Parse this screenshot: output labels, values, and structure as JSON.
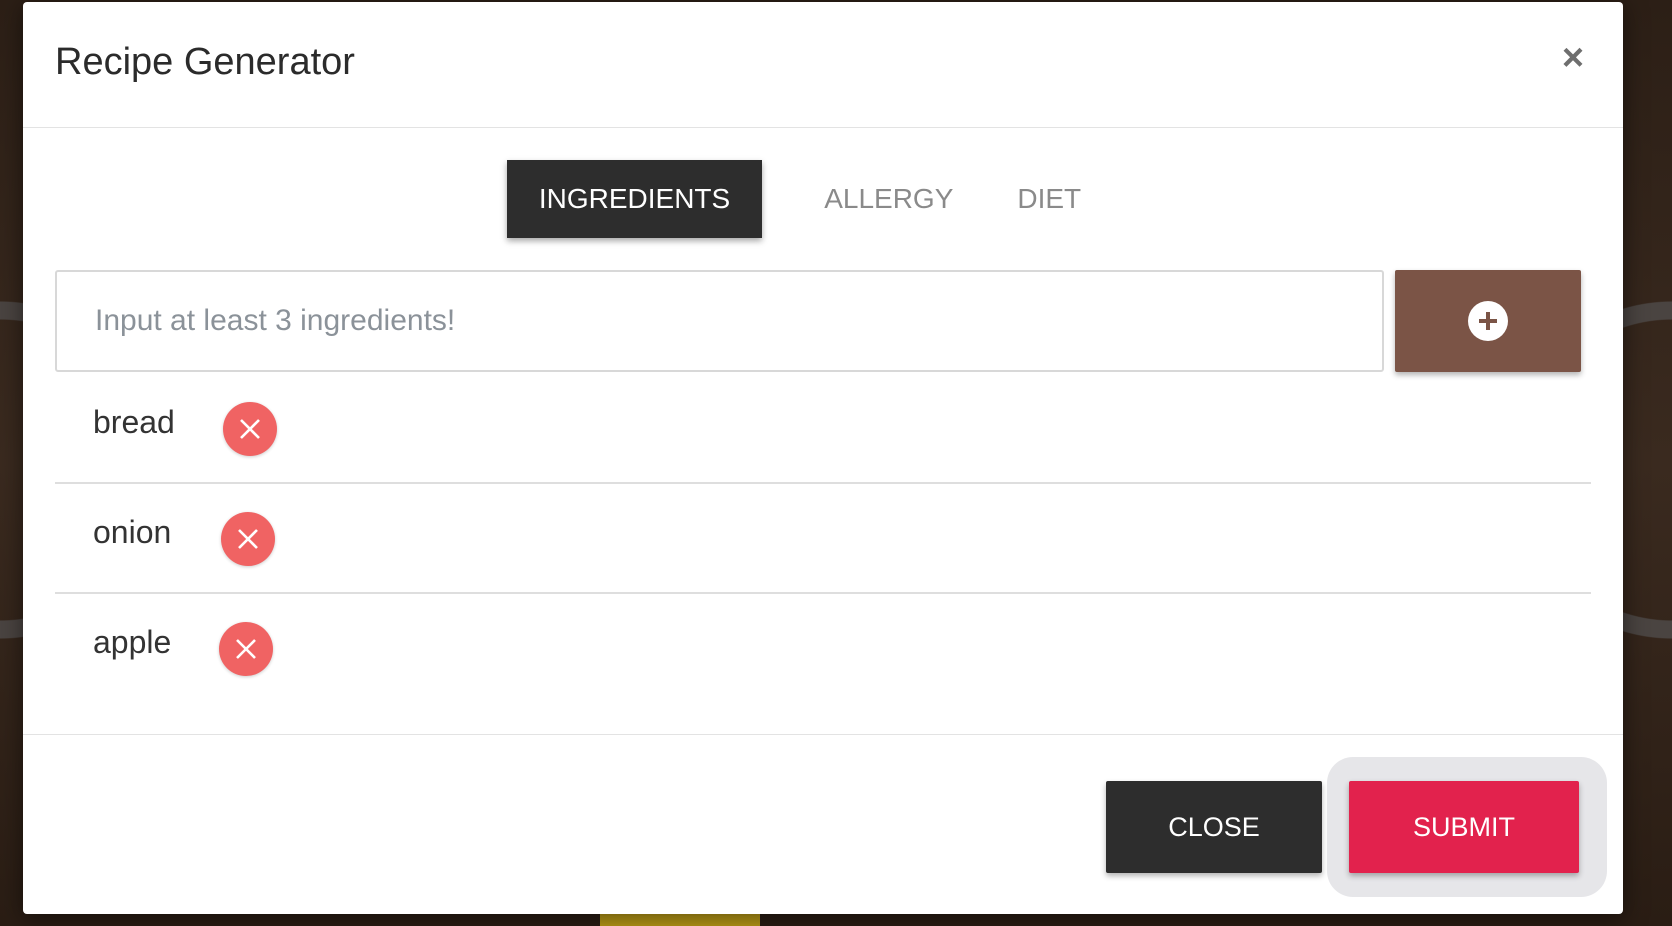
{
  "modal": {
    "title": "Recipe Generator",
    "close_glyph": "×"
  },
  "tabs": [
    {
      "label": "INGREDIENTS",
      "active": true
    },
    {
      "label": "ALLERGY",
      "active": false
    },
    {
      "label": "DIET",
      "active": false
    }
  ],
  "ingredient_input": {
    "value": "",
    "placeholder": "Input at least 3 ingredients!"
  },
  "ingredients": [
    {
      "label": "bread"
    },
    {
      "label": "onion"
    },
    {
      "label": "apple"
    }
  ],
  "footer": {
    "close_label": "CLOSE",
    "submit_label": "SUBMIT"
  },
  "colors": {
    "tab_active_bg": "#2d2d2d",
    "add_button": "#7b5446",
    "remove_button": "#f06363",
    "close_button": "#2d2d2d",
    "submit_button": "#e2224d"
  },
  "icons": {
    "add": "plus-circle-icon",
    "remove": "x-circle-icon",
    "dismiss": "close-icon"
  }
}
